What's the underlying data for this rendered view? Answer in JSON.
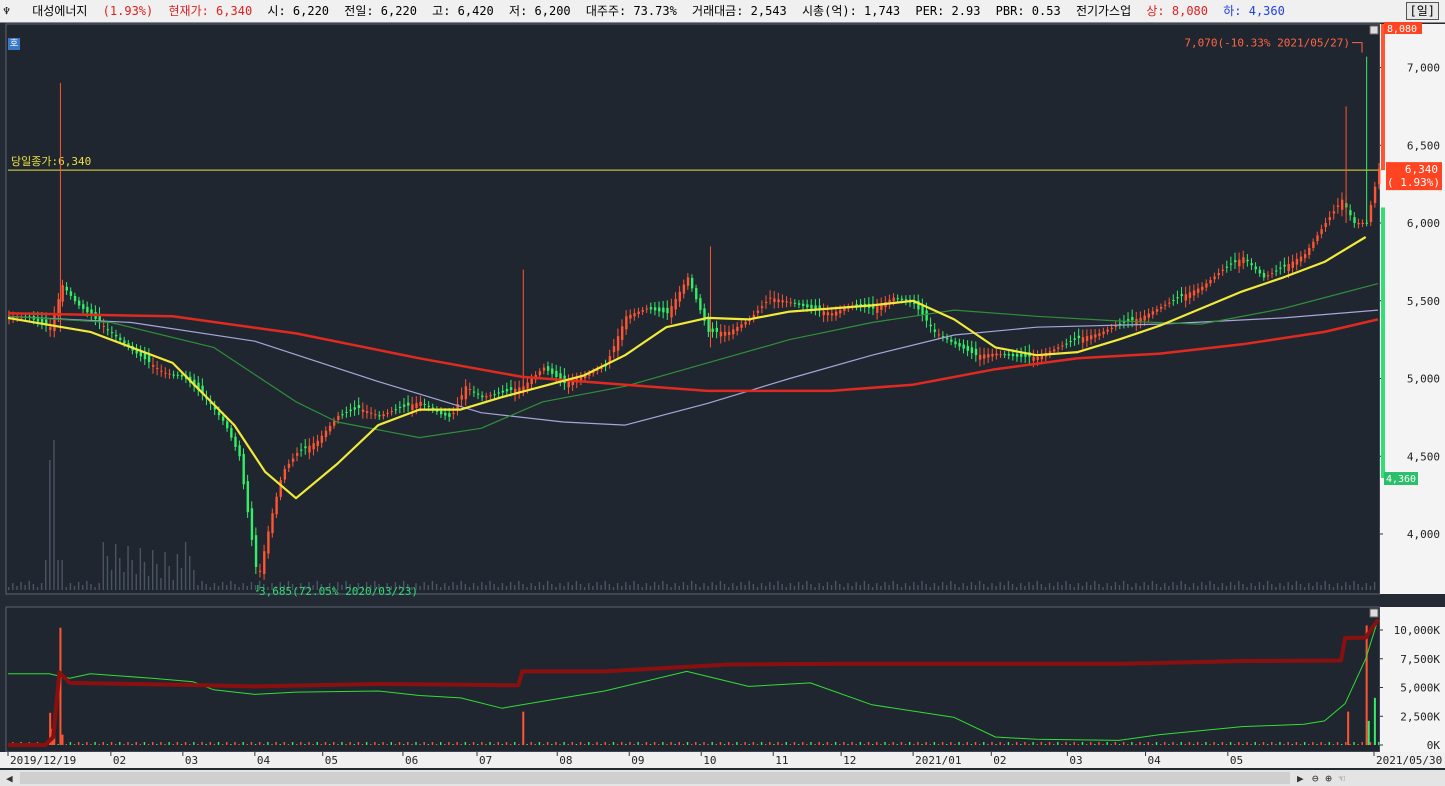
{
  "header": {
    "stock_name": "대성에너지",
    "change_pct": "(1.93%)",
    "current_price": "현재가: 6,340",
    "open": "시: 6,220",
    "prev_close": "전일: 6,220",
    "high": "고: 6,420",
    "low": "저: 6,200",
    "major_holder": "대주주: 73.73%",
    "trade_value": "거래대금: 2,543",
    "market_cap": "시총(억): 1,743",
    "per": "PER: 2.93",
    "pbr": "PBR: 0.53",
    "sector": "전기가스업",
    "upper_limit": "상: 8,080",
    "lower_limit": "하: 4,360",
    "period": "[일]"
  },
  "chart_data": {
    "type": "candlestick",
    "price_axis": {
      "ticks": [
        "7,000",
        "6,500",
        "6,000",
        "5,500",
        "5,000",
        "4,500",
        "4,000"
      ],
      "values": [
        7000,
        6500,
        6000,
        5500,
        5000,
        4500,
        4000
      ],
      "ylim": [
        3600,
        7400
      ]
    },
    "upper_limit_label": "8,080",
    "lower_limit_label": "4,360",
    "current_label": "6,340",
    "current_pct_label": "( 1.93%)",
    "close_line_label": "당일종가:6,340",
    "close_line_value": 6340,
    "high_annotation": "7,070(-10.33% 2021/05/27)",
    "low_annotation": "3,685(72.05% 2020/03/23)",
    "x_axis_labels": [
      "2019/12/19",
      "02",
      "03",
      "04",
      "05",
      "06",
      "07",
      "08",
      "09",
      "10",
      "11",
      "12",
      "2021/01",
      "02",
      "03",
      "04",
      "05",
      "2021/05/30"
    ],
    "price_path": [
      [
        0,
        5400
      ],
      [
        10,
        5390
      ],
      [
        20,
        5330
      ],
      [
        26,
        5600
      ],
      [
        33,
        5480
      ],
      [
        45,
        5350
      ],
      [
        60,
        5180
      ],
      [
        75,
        5040
      ],
      [
        85,
        5010
      ],
      [
        95,
        4890
      ],
      [
        105,
        4710
      ],
      [
        112,
        4500
      ],
      [
        117,
        4050
      ],
      [
        121,
        3700
      ],
      [
        127,
        4080
      ],
      [
        133,
        4400
      ],
      [
        140,
        4520
      ],
      [
        150,
        4600
      ],
      [
        160,
        4760
      ],
      [
        170,
        4810
      ],
      [
        180,
        4760
      ],
      [
        190,
        4810
      ],
      [
        200,
        4850
      ],
      [
        210,
        4770
      ],
      [
        215,
        4750
      ],
      [
        222,
        4950
      ],
      [
        230,
        4880
      ],
      [
        240,
        4910
      ],
      [
        250,
        4950
      ],
      [
        260,
        5070
      ],
      [
        270,
        4970
      ],
      [
        280,
        5020
      ],
      [
        290,
        5080
      ],
      [
        300,
        5400
      ],
      [
        310,
        5450
      ],
      [
        320,
        5420
      ],
      [
        330,
        5650
      ],
      [
        340,
        5300
      ],
      [
        350,
        5300
      ],
      [
        360,
        5380
      ],
      [
        370,
        5520
      ],
      [
        380,
        5490
      ],
      [
        390,
        5450
      ],
      [
        400,
        5420
      ],
      [
        410,
        5470
      ],
      [
        420,
        5450
      ],
      [
        430,
        5520
      ],
      [
        440,
        5480
      ],
      [
        450,
        5300
      ],
      [
        460,
        5220
      ],
      [
        470,
        5150
      ],
      [
        480,
        5160
      ],
      [
        490,
        5140
      ],
      [
        500,
        5140
      ],
      [
        510,
        5200
      ],
      [
        520,
        5260
      ],
      [
        530,
        5290
      ],
      [
        540,
        5350
      ],
      [
        550,
        5390
      ],
      [
        560,
        5460
      ],
      [
        570,
        5530
      ],
      [
        580,
        5590
      ],
      [
        590,
        5700
      ],
      [
        600,
        5780
      ],
      [
        610,
        5650
      ],
      [
        620,
        5720
      ],
      [
        630,
        5800
      ],
      [
        640,
        6000
      ],
      [
        648,
        6150
      ],
      [
        654,
        6000
      ],
      [
        660,
        6000
      ],
      [
        666,
        6350
      ]
    ],
    "ma_yellow": [
      [
        0,
        5390
      ],
      [
        40,
        5300
      ],
      [
        80,
        5100
      ],
      [
        110,
        4700
      ],
      [
        125,
        4400
      ],
      [
        140,
        4230
      ],
      [
        160,
        4450
      ],
      [
        180,
        4700
      ],
      [
        200,
        4800
      ],
      [
        220,
        4800
      ],
      [
        240,
        4880
      ],
      [
        260,
        4950
      ],
      [
        280,
        5020
      ],
      [
        300,
        5150
      ],
      [
        320,
        5330
      ],
      [
        340,
        5390
      ],
      [
        360,
        5380
      ],
      [
        380,
        5430
      ],
      [
        400,
        5450
      ],
      [
        420,
        5470
      ],
      [
        440,
        5500
      ],
      [
        460,
        5380
      ],
      [
        480,
        5200
      ],
      [
        500,
        5150
      ],
      [
        520,
        5170
      ],
      [
        540,
        5250
      ],
      [
        560,
        5340
      ],
      [
        580,
        5450
      ],
      [
        600,
        5560
      ],
      [
        620,
        5650
      ],
      [
        640,
        5750
      ],
      [
        660,
        5910
      ]
    ],
    "ma_green": [
      [
        0,
        5400
      ],
      [
        50,
        5360
      ],
      [
        100,
        5200
      ],
      [
        140,
        4850
      ],
      [
        160,
        4720
      ],
      [
        200,
        4620
      ],
      [
        230,
        4680
      ],
      [
        260,
        4850
      ],
      [
        300,
        4950
      ],
      [
        340,
        5100
      ],
      [
        380,
        5250
      ],
      [
        420,
        5360
      ],
      [
        460,
        5440
      ],
      [
        500,
        5400
      ],
      [
        540,
        5370
      ],
      [
        580,
        5350
      ],
      [
        620,
        5450
      ],
      [
        666,
        5610
      ]
    ],
    "ma_lavender": [
      [
        0,
        5400
      ],
      [
        60,
        5360
      ],
      [
        120,
        5240
      ],
      [
        180,
        4980
      ],
      [
        230,
        4780
      ],
      [
        270,
        4720
      ],
      [
        300,
        4700
      ],
      [
        340,
        4840
      ],
      [
        380,
        5000
      ],
      [
        420,
        5150
      ],
      [
        460,
        5280
      ],
      [
        500,
        5330
      ],
      [
        560,
        5350
      ],
      [
        620,
        5390
      ],
      [
        666,
        5440
      ]
    ],
    "ma_red": [
      [
        0,
        5420
      ],
      [
        80,
        5400
      ],
      [
        140,
        5290
      ],
      [
        200,
        5130
      ],
      [
        250,
        5010
      ],
      [
        300,
        4960
      ],
      [
        340,
        4920
      ],
      [
        400,
        4920
      ],
      [
        440,
        4960
      ],
      [
        480,
        5060
      ],
      [
        520,
        5130
      ],
      [
        560,
        5160
      ],
      [
        600,
        5220
      ],
      [
        640,
        5300
      ],
      [
        666,
        5380
      ]
    ],
    "volume_axis": {
      "ticks": [
        "10,000K",
        "7,500K",
        "5,000K",
        "2,500K",
        "0K"
      ],
      "values": [
        10000,
        7500,
        5000,
        2500,
        0
      ],
      "ylim": [
        0,
        11000
      ]
    },
    "volume_spikes": [
      [
        20,
        2800
      ],
      [
        21,
        1400
      ],
      [
        22,
        2300
      ],
      [
        25,
        10200
      ],
      [
        26,
        900
      ],
      [
        250,
        2900
      ],
      [
        651,
        2900
      ],
      [
        660,
        10400
      ],
      [
        661,
        2100
      ],
      [
        664,
        4100
      ]
    ],
    "obv_dark_red": [
      [
        0,
        0
      ],
      [
        18,
        0
      ],
      [
        22,
        700
      ],
      [
        25,
        6300
      ],
      [
        30,
        5400
      ],
      [
        80,
        5250
      ],
      [
        120,
        5100
      ],
      [
        180,
        5300
      ],
      [
        220,
        5250
      ],
      [
        240,
        5200
      ],
      [
        248,
        5200
      ],
      [
        250,
        6400
      ],
      [
        290,
        6400
      ],
      [
        350,
        7000
      ],
      [
        400,
        7050
      ],
      [
        480,
        7050
      ],
      [
        540,
        7050
      ],
      [
        600,
        7300
      ],
      [
        648,
        7350
      ],
      [
        650,
        9300
      ],
      [
        660,
        9350
      ],
      [
        666,
        10900
      ]
    ],
    "obv_green": [
      [
        0,
        6200
      ],
      [
        20,
        6200
      ],
      [
        30,
        5800
      ],
      [
        40,
        6200
      ],
      [
        70,
        5800
      ],
      [
        90,
        5500
      ],
      [
        100,
        4800
      ],
      [
        120,
        4400
      ],
      [
        140,
        4600
      ],
      [
        180,
        4700
      ],
      [
        200,
        4300
      ],
      [
        220,
        4100
      ],
      [
        240,
        3200
      ],
      [
        260,
        3800
      ],
      [
        290,
        4700
      ],
      [
        330,
        6400
      ],
      [
        360,
        5100
      ],
      [
        390,
        5400
      ],
      [
        420,
        3500
      ],
      [
        460,
        2400
      ],
      [
        480,
        700
      ],
      [
        500,
        500
      ],
      [
        540,
        400
      ],
      [
        560,
        900
      ],
      [
        600,
        1600
      ],
      [
        630,
        1800
      ],
      [
        640,
        2100
      ],
      [
        650,
        3600
      ],
      [
        660,
        7500
      ],
      [
        666,
        10900
      ]
    ]
  }
}
